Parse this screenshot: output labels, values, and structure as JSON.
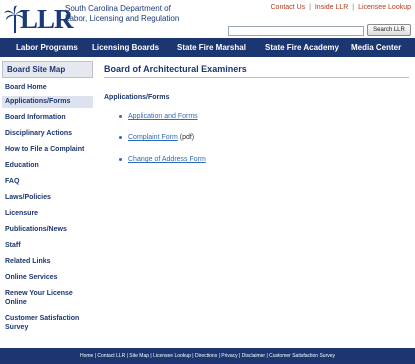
{
  "header": {
    "logo_letters": "LLR",
    "logo_line1": "South Carolina Department of",
    "logo_line2": "Labor, Licensing and Regulation",
    "top_links": [
      "Contact Us",
      "Inside LLR",
      "Licensee Lookup"
    ],
    "top_link_sep": "|",
    "search_button": "Search LLR",
    "search_value": ""
  },
  "nav": {
    "items": [
      "Labor Programs",
      "Licensing Boards",
      "State Fire Marshal",
      "State Fire Academy",
      "Media Center"
    ]
  },
  "sidebar": {
    "title": "Board Site Map",
    "items": [
      "Board Home",
      "Applications/Forms",
      "Board Information",
      "Disciplinary Actions",
      "How to File a Complaint",
      "Education",
      "FAQ",
      "Laws/Policies",
      "Licensure",
      "Publications/News",
      "Staff",
      "Related Links",
      "Online Services",
      "Renew Your License Online",
      "Customer Satisfaction Survey"
    ],
    "active_index": 1
  },
  "main": {
    "title": "Board of Architectural Examiners",
    "section_heading": "Applications/Forms",
    "links": [
      {
        "label": "Application and Forms",
        "note": ""
      },
      {
        "label": "Complaint Form",
        "note": " (pdf)"
      },
      {
        "label": "Change of Address Form",
        "note": ""
      }
    ]
  },
  "footer": {
    "text": "Home | Contact LLR | Site Map | Licensee Lookup | Directions | Privacy | Disclaimer | Customer Satisfaction Survey"
  },
  "colors": {
    "navy": "#1b3670",
    "link_blue": "#2f6bb8",
    "top_link_red": "#b23b1d"
  }
}
